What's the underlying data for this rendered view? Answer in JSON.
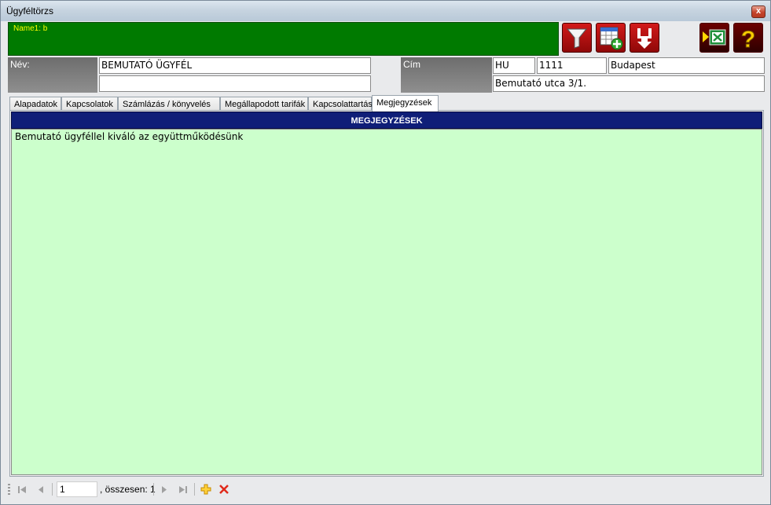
{
  "window": {
    "title": "Ügyféltörzs",
    "close": "x"
  },
  "greenbar": {
    "label": "Name1: b"
  },
  "toolbar": {
    "buttons": [
      {
        "name": "filter",
        "icon": "filter-icon"
      },
      {
        "name": "add-record",
        "icon": "add-table-icon"
      },
      {
        "name": "save",
        "icon": "save-arrow-icon"
      },
      {
        "name": "export-excel",
        "icon": "excel-export-icon"
      },
      {
        "name": "help",
        "icon": "help-icon",
        "glyph": "?"
      }
    ]
  },
  "customer": {
    "name_label": "Név:",
    "name": "BEMUTATÓ ÜGYFÉL",
    "name2": "",
    "address_label": "Cím",
    "country": "HU",
    "zip": "1111",
    "city": "Budapest",
    "street": "Bemutató utca 3/1."
  },
  "tabs": [
    {
      "label": "Alapadatok"
    },
    {
      "label": "Kapcsolatok"
    },
    {
      "label": "Számlázás / könyvelés"
    },
    {
      "label": "Megállapodott tarifák"
    },
    {
      "label": "Kapcsolattartás"
    },
    {
      "label": "Megjegyzések",
      "active": true
    }
  ],
  "notes": {
    "header": "MEGJEGYZÉSEK",
    "text": "Bemutató ügyféllel kiváló az együttműködésünk"
  },
  "navigator": {
    "page": "1",
    "total_text": ", összesen: 1"
  },
  "colors": {
    "green_bar": "#007a00",
    "header_blue": "#0f1e78",
    "notes_bg": "#ccffcc",
    "button_red": "#c21010"
  }
}
